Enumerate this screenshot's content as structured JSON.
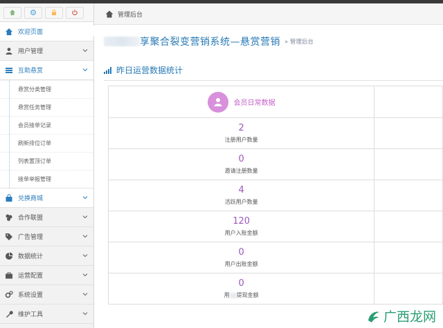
{
  "breadcrumb": {
    "label": "管理后台"
  },
  "page": {
    "title": "享聚合裂变营销系统—悬赏营销",
    "subcrumb": "» 管理后台"
  },
  "section": {
    "title": "昨日运营数据统计"
  },
  "sidebar": {
    "items": [
      {
        "label": "欢迎页面",
        "icon": "home-icon"
      },
      {
        "label": "用户管理",
        "icon": "user-icon"
      },
      {
        "label": "互助悬赏",
        "icon": "list-icon"
      },
      {
        "label": "兑换商城",
        "icon": "shopping-bag-icon"
      },
      {
        "label": "合作联盟",
        "icon": "coins-icon"
      },
      {
        "label": "广告管理",
        "icon": "tag-icon"
      },
      {
        "label": "数据统计",
        "icon": "pie-chart-icon"
      },
      {
        "label": "运营配置",
        "icon": "briefcase-icon"
      },
      {
        "label": "系统设置",
        "icon": "cogs-icon"
      },
      {
        "label": "维护工具",
        "icon": "wrench-icon"
      }
    ],
    "submenu": [
      "悬赏分类管理",
      "悬赏任务管理",
      "会员接单记录",
      "刷新排位订单",
      "列表置顶订单",
      "接单举报管理"
    ]
  },
  "stats": {
    "header": "会员日常数据",
    "rows": [
      {
        "value": "2",
        "label": "注册用户数量"
      },
      {
        "value": "0",
        "label": "邀请注册数量"
      },
      {
        "value": "4",
        "label": "活跃用户数量"
      },
      {
        "value": "120",
        "label": "用户入账金额"
      },
      {
        "value": "0",
        "label": "用户出账金额"
      },
      {
        "value": "0",
        "label_prefix": "用",
        "label_suffix": "提现金额"
      }
    ]
  },
  "watermark": {
    "text": "广西龙网"
  },
  "colors": {
    "accent": "#2679b5",
    "stat_value": "#9a57b9",
    "header_circle": "#d88fdc"
  }
}
